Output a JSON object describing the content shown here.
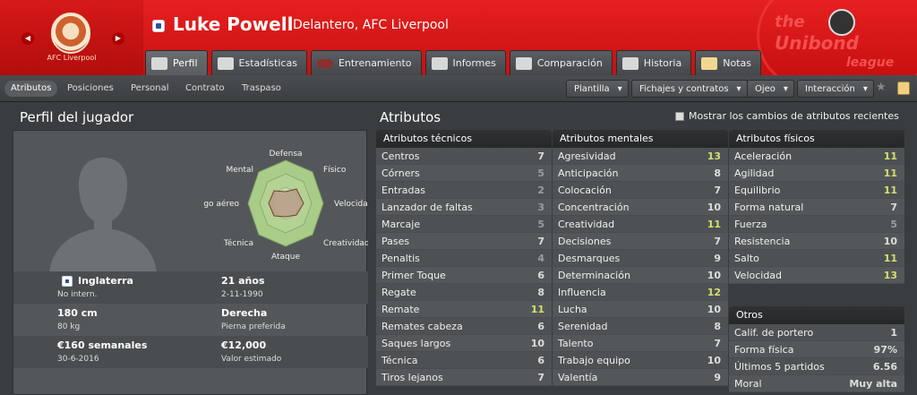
{
  "header": {
    "club_crest_label": "AFC Liverpool",
    "player_name": "Luke Powell",
    "player_sub": "Delantero, AFC Liverpool",
    "league_logo": [
      "the",
      "Unibond",
      "league"
    ]
  },
  "tabs": [
    {
      "label": "Perfil",
      "active": true
    },
    {
      "label": "Estadísticas"
    },
    {
      "label": "Entrenamiento"
    },
    {
      "label": "Informes"
    },
    {
      "label": "Comparación"
    },
    {
      "label": "Historia"
    },
    {
      "label": "Notas"
    }
  ],
  "subnav": {
    "items": [
      "Atributos",
      "Posiciones",
      "Personal",
      "Contrato",
      "Traspaso"
    ],
    "dropdowns": [
      "Plantilla",
      "Fichajes y contratos",
      "Ojeo",
      "Interacción"
    ]
  },
  "profile": {
    "title": "Perfil del jugador",
    "radar_labels": [
      "Defensa",
      "Físico",
      "Velocidad",
      "Creatividad",
      "Ataque",
      "Técnica",
      "Juego aéreo",
      "Mental"
    ],
    "nationality": "Inglaterra",
    "intl": "No intern.",
    "age": "21 años",
    "dob": "2-11-1990",
    "height": "180 cm",
    "weight": "80 kg",
    "foot": "Derecha",
    "foot_label": "Pierna preferida",
    "wage": "€160 semanales",
    "contract_end": "30-6-2016",
    "value": "€12,000",
    "value_label": "Valor estimado"
  },
  "attributes": {
    "title": "Atributos",
    "show_changes_label": "Mostrar los cambios de atributos recientes",
    "technical": {
      "header": "Atributos técnicos",
      "rows": [
        {
          "name": "Centros",
          "value": "7"
        },
        {
          "name": "Córners",
          "value": "5"
        },
        {
          "name": "Entradas",
          "value": "2"
        },
        {
          "name": "Lanzador de faltas",
          "value": "3"
        },
        {
          "name": "Marcaje",
          "value": "5"
        },
        {
          "name": "Pases",
          "value": "7"
        },
        {
          "name": "Penaltis",
          "value": "4"
        },
        {
          "name": "Primer Toque",
          "value": "6"
        },
        {
          "name": "Regate",
          "value": "8"
        },
        {
          "name": "Remate",
          "value": "11"
        },
        {
          "name": "Remates cabeza",
          "value": "6"
        },
        {
          "name": "Saques largos",
          "value": "10"
        },
        {
          "name": "Técnica",
          "value": "6"
        },
        {
          "name": "Tiros lejanos",
          "value": "7"
        }
      ]
    },
    "mental": {
      "header": "Atributos mentales",
      "rows": [
        {
          "name": "Agresividad",
          "value": "13"
        },
        {
          "name": "Anticipación",
          "value": "8"
        },
        {
          "name": "Colocación",
          "value": "7"
        },
        {
          "name": "Concentración",
          "value": "10"
        },
        {
          "name": "Creatividad",
          "value": "11"
        },
        {
          "name": "Decisiones",
          "value": "7"
        },
        {
          "name": "Desmarques",
          "value": "9"
        },
        {
          "name": "Determinación",
          "value": "10"
        },
        {
          "name": "Influencia",
          "value": "12"
        },
        {
          "name": "Lucha",
          "value": "10"
        },
        {
          "name": "Serenidad",
          "value": "8"
        },
        {
          "name": "Talento",
          "value": "7"
        },
        {
          "name": "Trabajo equipo",
          "value": "10"
        },
        {
          "name": "Valentía",
          "value": "9"
        }
      ]
    },
    "physical": {
      "header": "Atributos físicos",
      "rows": [
        {
          "name": "Aceleración",
          "value": "11"
        },
        {
          "name": "Agilidad",
          "value": "11"
        },
        {
          "name": "Equilibrio",
          "value": "11"
        },
        {
          "name": "Forma natural",
          "value": "7"
        },
        {
          "name": "Fuerza",
          "value": "5"
        },
        {
          "name": "Resistencia",
          "value": "10"
        },
        {
          "name": "Salto",
          "value": "11"
        },
        {
          "name": "Velocidad",
          "value": "13"
        }
      ]
    },
    "other": {
      "header": "Otros",
      "rows": [
        {
          "name": "Calif. de portero",
          "value": "1"
        },
        {
          "name": "Forma física",
          "value": "97%"
        },
        {
          "name": "Últimos 5 partidos",
          "value": "6.56"
        },
        {
          "name": "Moral",
          "value": "Muy alta"
        }
      ]
    }
  }
}
